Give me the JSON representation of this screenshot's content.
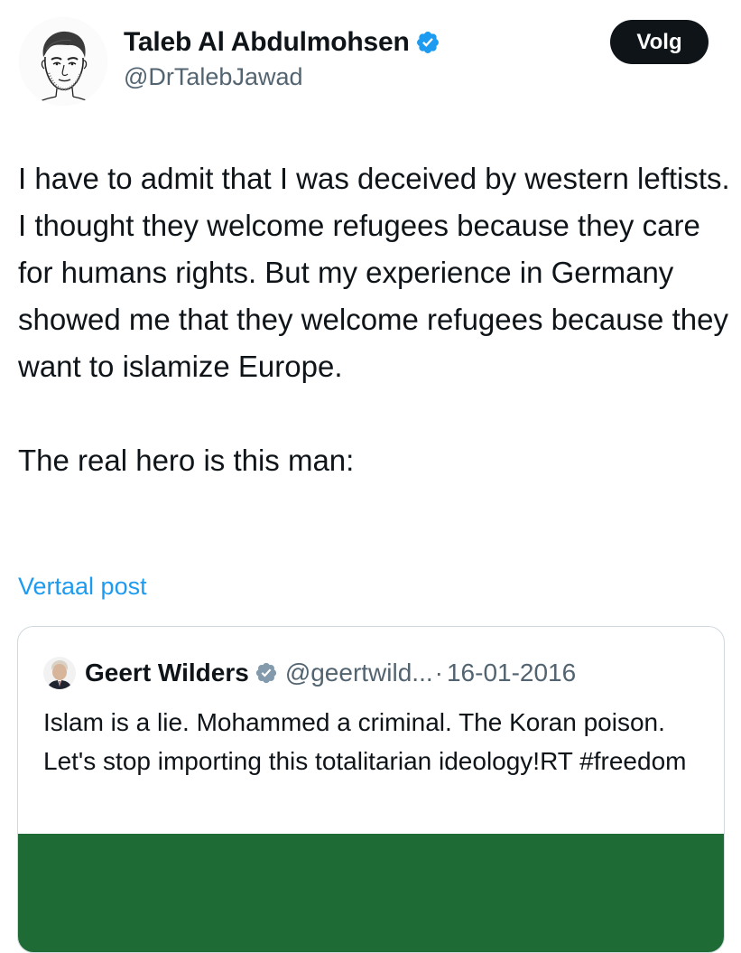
{
  "author": {
    "display_name": "Taleb Al Abdulmohsen",
    "handle": "@DrTalebJawad",
    "avatar_icon": "sketch-portrait-avatar",
    "verified_icon": "verified-badge-icon"
  },
  "actions": {
    "follow_label": "Volg"
  },
  "post": {
    "paragraph_1": "I have to admit that I was deceived by western leftists. I thought they welcome refugees because they care for humans rights. But my experience in Germany showed me that they welcome refugees because they want to islamize Europe.",
    "paragraph_2": "The real hero is this man:",
    "translate_label": "Vertaal post"
  },
  "quoted_post": {
    "display_name": "Geert Wilders",
    "handle": "@geertwild...",
    "separator": "·",
    "date": "16-01-2016",
    "text": "Islam is a lie. Mohammed a criminal. The Koran poison. Let's stop importing this totalitarian ideology!RT  #freedom",
    "verified_icon": "verified-badge-gray-icon"
  },
  "colors": {
    "text_primary": "#0f1419",
    "text_secondary": "#536471",
    "link_blue": "#1d9bf0",
    "verified_blue": "#1d9bf0",
    "verified_gray": "#829aab",
    "border": "#cfd9de",
    "media_green": "#1f6b35",
    "button_bg": "#0f1419"
  }
}
